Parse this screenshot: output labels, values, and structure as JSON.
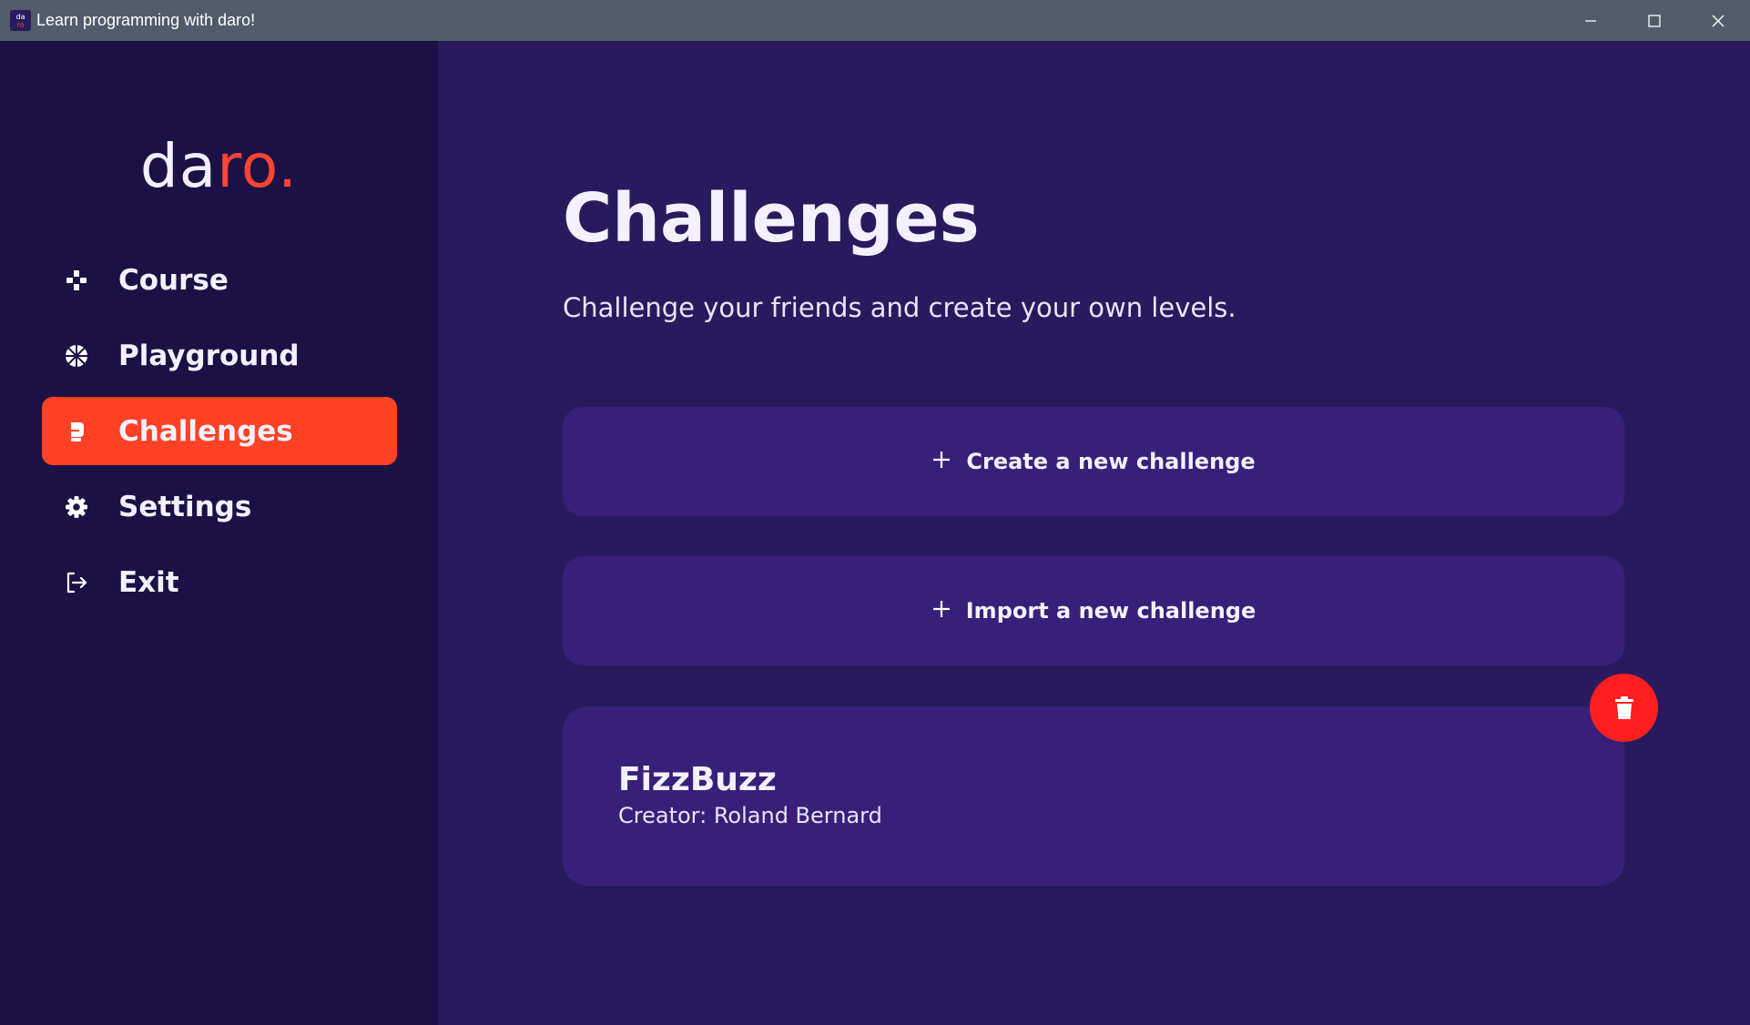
{
  "window": {
    "title": "Learn programming with daro!",
    "icon_text_top": "da",
    "icon_text_bottom": "ro",
    "controls": [
      "minimize-icon",
      "maximize-icon",
      "close-icon"
    ]
  },
  "sidebar": {
    "logo_main": "da",
    "logo_accent": "ro.",
    "items": [
      {
        "label": "Course",
        "icon": "gamepad-icon",
        "active": false
      },
      {
        "label": "Playground",
        "icon": "basketball-icon",
        "active": false
      },
      {
        "label": "Challenges",
        "icon": "boxing-glove-icon",
        "active": true
      },
      {
        "label": "Settings",
        "icon": "gear-icon",
        "active": false
      },
      {
        "label": "Exit",
        "icon": "sign-out-icon",
        "active": false
      }
    ]
  },
  "main": {
    "title": "Challenges",
    "subtitle": "Challenge your friends and create your own levels.",
    "actions": [
      {
        "label": "Create a new challenge",
        "icon": "plus-icon"
      },
      {
        "label": "Import a new challenge",
        "icon": "plus-icon"
      }
    ],
    "challenges": [
      {
        "name": "FizzBuzz",
        "creator": "Creator: Roland Bernard",
        "delete_icon": "trash-icon"
      }
    ]
  },
  "colors": {
    "titlebar": "#515c6b",
    "sidebar_bg": "#1c1145",
    "main_bg": "#291a5d",
    "card_bg": "#38207a",
    "accent": "#ff4126",
    "delete": "#ff1f1f",
    "text": "#f4f1ff"
  }
}
